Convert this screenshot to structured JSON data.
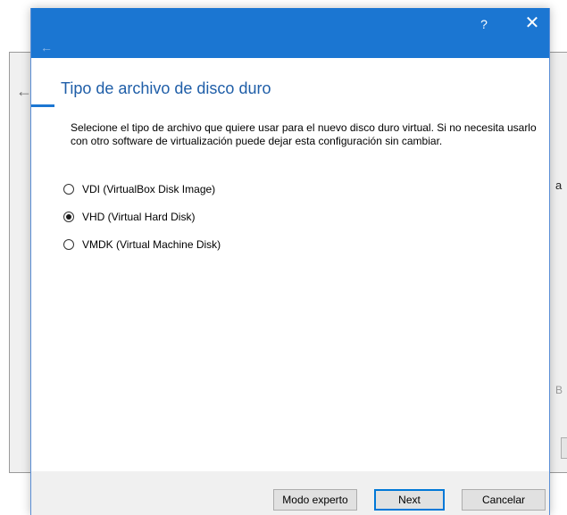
{
  "background": {
    "back_arrow": "←",
    "fragment_a": "a",
    "fragment_b": "B"
  },
  "titlebar": {
    "help": "?",
    "close": "✕",
    "back": "←"
  },
  "page": {
    "title": "Tipo de archivo de disco duro",
    "description": "Selecione el tipo de archivo que quiere usar para el nuevo disco duro virtual. Si no necesita usarlo con otro software de virtualización puede dejar esta configuración sin cambiar."
  },
  "options": [
    {
      "label": "VDI (VirtualBox Disk Image)",
      "selected": false
    },
    {
      "label": "VHD (Virtual Hard Disk)",
      "selected": true
    },
    {
      "label": "VMDK (Virtual Machine Disk)",
      "selected": false
    }
  ],
  "buttons": {
    "expert": "Modo experto",
    "next": "Next",
    "cancel": "Cancelar"
  }
}
